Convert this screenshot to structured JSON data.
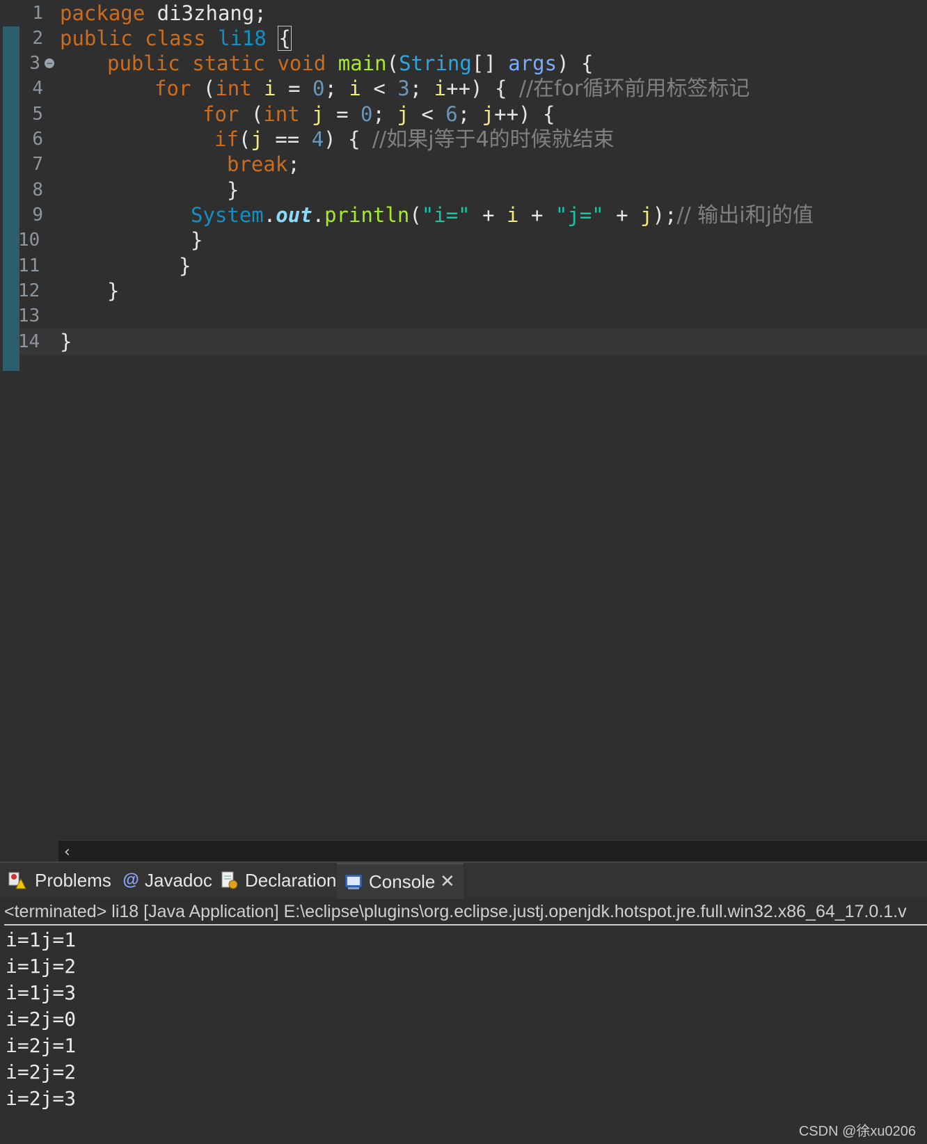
{
  "editor": {
    "line_numbers": [
      "1",
      "2",
      "3",
      "4",
      "5",
      "6",
      "7",
      "8",
      "9",
      "10",
      "11",
      "12",
      "13",
      "14"
    ],
    "line1": {
      "kw": "package",
      "rest": " di3zhang;"
    },
    "line2": {
      "kw1": "public",
      "kw2": "class",
      "cls": "li18",
      "brace": "{"
    },
    "line3": {
      "kw1": "public",
      "kw2": "static",
      "kw3": "void",
      "method": "main",
      "open": "(",
      "ptype": "String",
      "arr": "[]",
      "param": "args",
      "close": ") {"
    },
    "line4": {
      "kw": "for",
      "p1": " (",
      "type": "int",
      "sp1": " ",
      "var1": "i",
      "eq": " = ",
      "n0": "0",
      "semi1": "; ",
      "var2": "i",
      "lt": " < ",
      "n3": "3",
      "semi2": "; ",
      "var3": "i",
      "inc": "++) { ",
      "comment": "//在for循环前用标签标记"
    },
    "line5": {
      "kw": "for",
      "p1": " (",
      "type": "int",
      "sp1": " ",
      "var1": "j",
      "eq": " = ",
      "n0": "0",
      "semi1": "; ",
      "var2": "j",
      "lt": " < ",
      "n6": "6",
      "semi2": "; ",
      "var3": "j",
      "inc": "++) {"
    },
    "line6": {
      "kw": "if",
      "p1": "(",
      "var": "j",
      "eq": " == ",
      "n4": "4",
      "p2": ") { ",
      "comment": "//如果j等于4的时候就结束"
    },
    "line7": {
      "kw": "break",
      "semi": ";"
    },
    "line8": {
      "brace": "}"
    },
    "line9": {
      "cls": "System",
      "dot1": ".",
      "field": "out",
      "dot2": ".",
      "method": "println",
      "p1": "(",
      "s1": "\"i=\"",
      "plus1": " + ",
      "var1": "i",
      "plus2": " + ",
      "s2": "\"j=\"",
      "plus3": " + ",
      "var2": "j",
      "p2": ");",
      "comment": "// 输出i和j的值"
    },
    "line10": {
      "brace": "}"
    },
    "line11": {
      "brace": "}"
    },
    "line12": {
      "brace": "}"
    },
    "line14": {
      "brace": "}"
    },
    "scroll_left_glyph": "‹"
  },
  "panel": {
    "tabs": [
      {
        "label": "Problems",
        "icon": "problems-icon"
      },
      {
        "label": "Javadoc",
        "icon": "javadoc-icon"
      },
      {
        "label": "Declaration",
        "icon": "declaration-icon"
      },
      {
        "label": "Console",
        "icon": "console-icon",
        "active": true
      }
    ],
    "close_glyph": "✕",
    "status": "<terminated> li18 [Java Application] E:\\eclipse\\plugins\\org.eclipse.justj.openjdk.hotspot.jre.full.win32.x86_64_17.0.1.v",
    "output": [
      "i=1j=1",
      "i=1j=2",
      "i=1j=3",
      "i=2j=0",
      "i=2j=1",
      "i=2j=2",
      "i=2j=3"
    ]
  },
  "watermark": "CSDN @徐xu0206",
  "colors": {
    "background": "#2f2f2f",
    "keyword": "#cc6c1d",
    "type": "#1290c3",
    "variable": "#f3ec79",
    "number": "#6897bb",
    "method": "#a7ec21",
    "string": "#17c6a3",
    "comment": "#808080"
  }
}
